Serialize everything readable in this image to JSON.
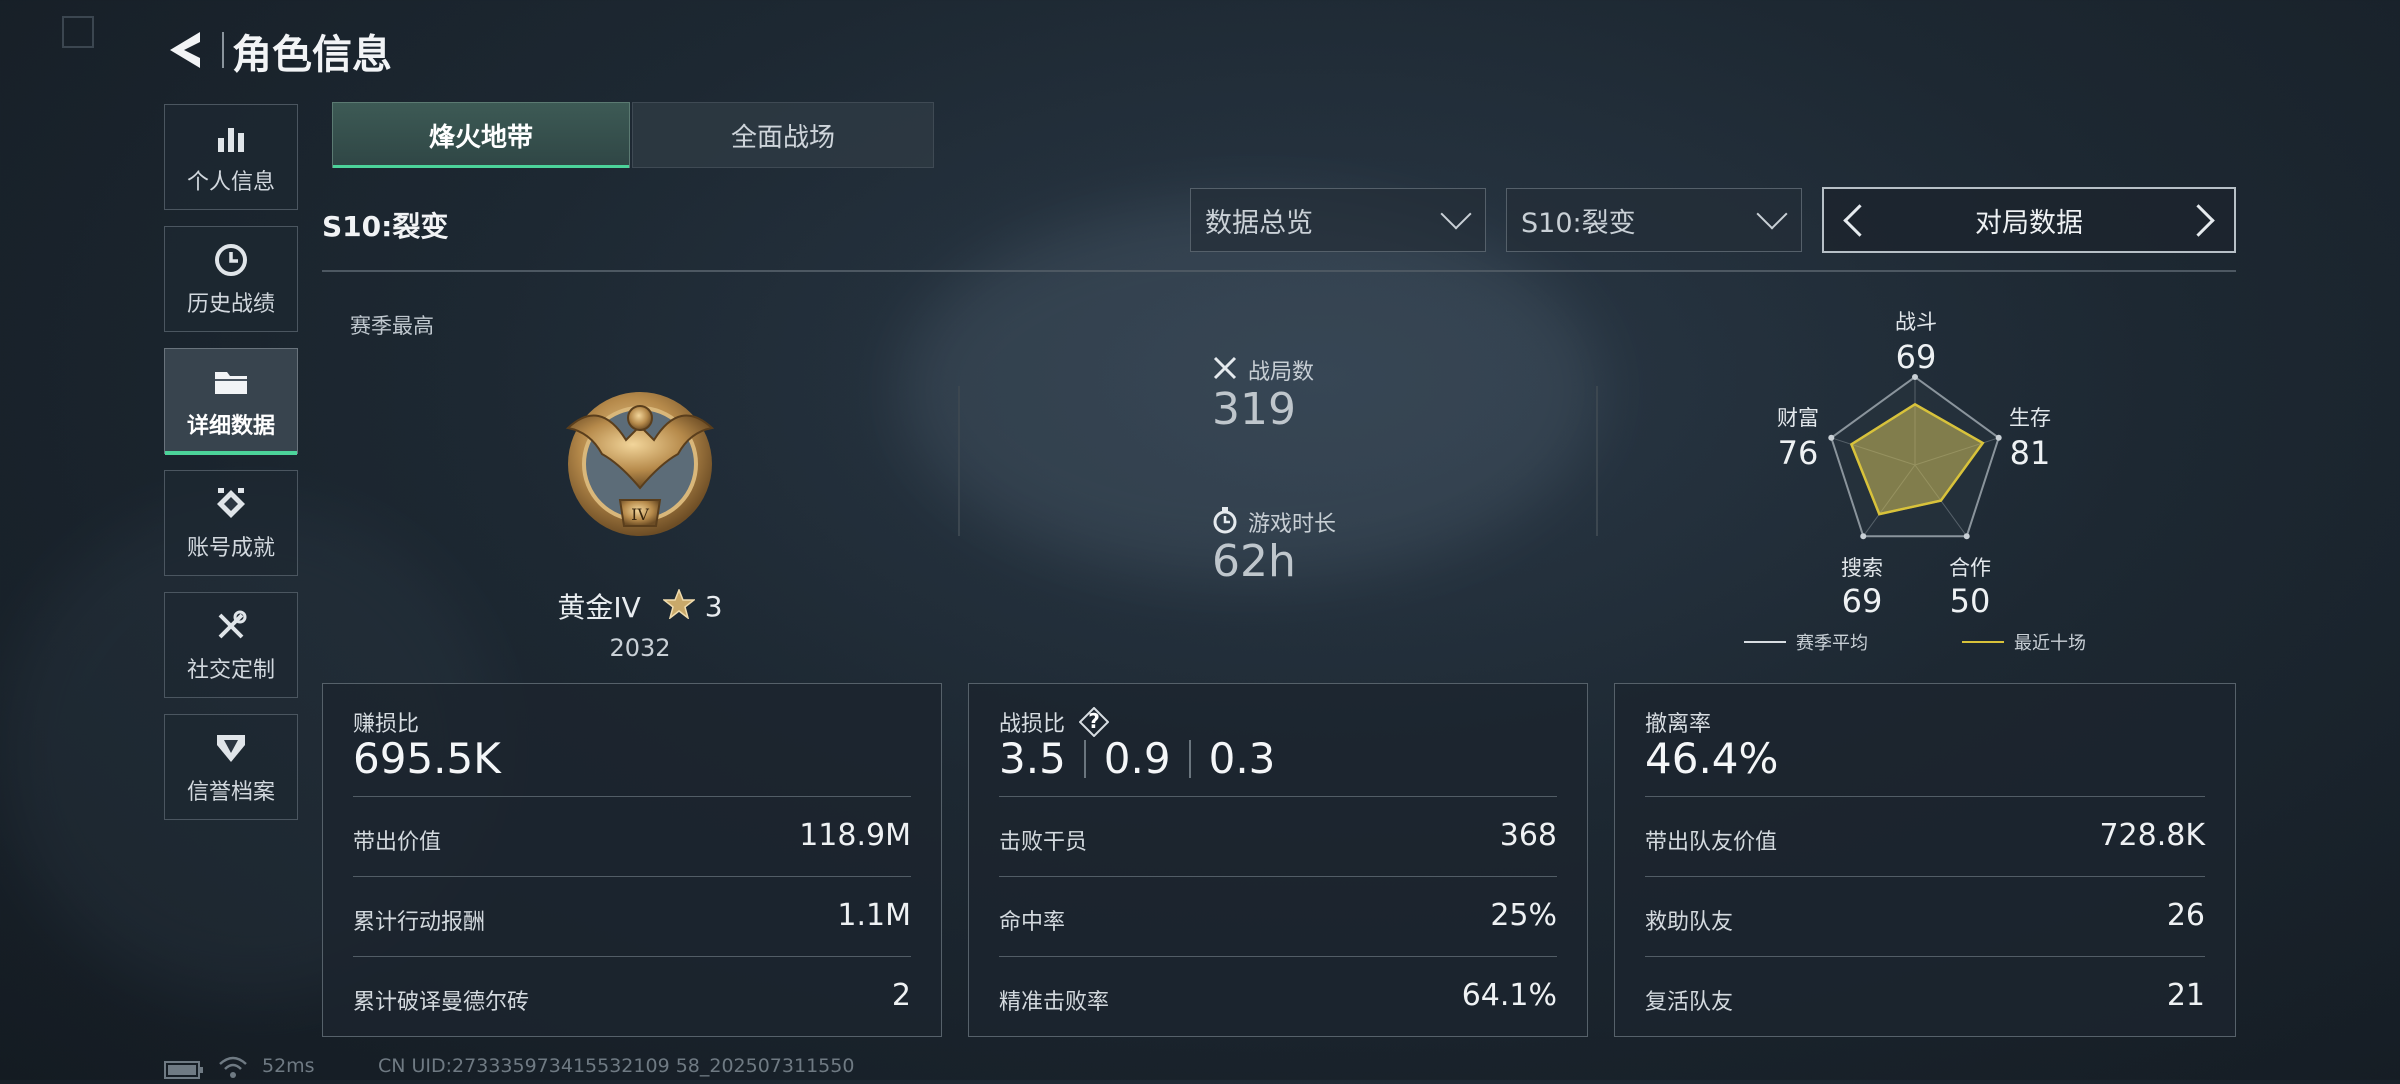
{
  "header": {
    "title": "角色信息"
  },
  "sidebar": {
    "items": [
      {
        "label": "个人信息",
        "icon": "bar-chart-icon"
      },
      {
        "label": "历史战绩",
        "icon": "clock-icon"
      },
      {
        "label": "详细数据",
        "icon": "folder-icon",
        "active": true
      },
      {
        "label": "账号成就",
        "icon": "badge-icon"
      },
      {
        "label": "社交定制",
        "icon": "tools-icon"
      },
      {
        "label": "信誉档案",
        "icon": "shield-icon"
      }
    ]
  },
  "tabs": [
    {
      "label": "烽火地带",
      "active": true
    },
    {
      "label": "全面战场",
      "active": false
    }
  ],
  "season": {
    "title": "S10:裂变"
  },
  "filters": {
    "view": "数据总览",
    "season": "S10:裂变",
    "pager_label": "对局数据"
  },
  "season_best": {
    "label": "赛季最高",
    "rank": "黄金IV",
    "stars": "3",
    "score": "2032",
    "badge_roman": "IV"
  },
  "stats": {
    "matches_label": "战局数",
    "matches": "319",
    "playtime_label": "游戏时长",
    "playtime": "62h"
  },
  "radar": {
    "axes": [
      {
        "label": "战斗",
        "value": "69"
      },
      {
        "label": "生存",
        "value": "81"
      },
      {
        "label": "合作",
        "value": "50"
      },
      {
        "label": "搜索",
        "value": "69"
      },
      {
        "label": "财富",
        "value": "76"
      }
    ],
    "legend": {
      "season_avg": "赛季平均",
      "recent10": "最近十场"
    },
    "colors": {
      "season_avg": "#d8dde2",
      "recent10": "#d8c23a"
    }
  },
  "cards": [
    {
      "title": "赚损比",
      "big": "695.5K",
      "rows": [
        {
          "label": "带出价值",
          "value": "118.9M"
        },
        {
          "label": "累计行动报酬",
          "value": "1.1M"
        },
        {
          "label": "累计破译曼德尔砖",
          "value": "2"
        }
      ]
    },
    {
      "title": "战损比",
      "help": "?",
      "kd": [
        "3.5",
        "0.9",
        "0.3"
      ],
      "rows": [
        {
          "label": "击败干员",
          "value": "368"
        },
        {
          "label": "命中率",
          "value": "25%"
        },
        {
          "label": "精准击败率",
          "value": "64.1%"
        }
      ]
    },
    {
      "title": "撤离率",
      "big": "46.4%",
      "rows": [
        {
          "label": "带出队友价值",
          "value": "728.8K"
        },
        {
          "label": "救助队友",
          "value": "26"
        },
        {
          "label": "复活队友",
          "value": "21"
        }
      ]
    }
  ],
  "footer": {
    "ping": "52ms",
    "uid": "CN UID:273335973415532109 58_202507311550"
  }
}
